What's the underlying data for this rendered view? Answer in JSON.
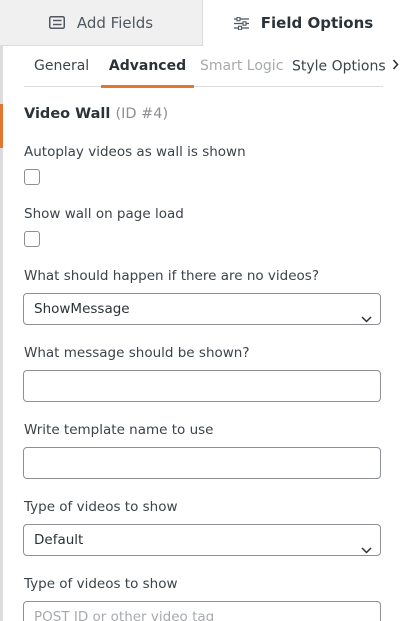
{
  "top_tabs": {
    "add_fields": "Add Fields",
    "field_options": "Field Options"
  },
  "sub_tabs": {
    "general": "General",
    "advanced": "Advanced",
    "smart_logic": "Smart Logic",
    "style_options": "Style Options"
  },
  "section": {
    "title": "Video Wall",
    "id_text": "(ID #4)"
  },
  "fields": {
    "autoplay": {
      "label": "Autoplay videos as wall is shown",
      "checked": false
    },
    "show_on_load": {
      "label": "Show wall on page load",
      "checked": false
    },
    "no_videos": {
      "label": "What should happen if there are no videos?",
      "value": "ShowMessage"
    },
    "message": {
      "label": "What message should be shown?",
      "value": ""
    },
    "template": {
      "label": "Write template name to use",
      "value": ""
    },
    "video_type": {
      "label": "Type of videos to show",
      "value": "Default"
    },
    "video_tag": {
      "label": "Type of videos to show",
      "placeholder": "POST ID or other video tag"
    }
  },
  "colors": {
    "accent": "#e27730",
    "tab_inactive_bg": "#f0f0f1",
    "border": "#8c8f94"
  },
  "icons": {
    "add_fields": "list-icon",
    "field_options": "sliders-icon",
    "select": "chevron-down-icon",
    "more_tabs": "chevron-right-icon"
  }
}
